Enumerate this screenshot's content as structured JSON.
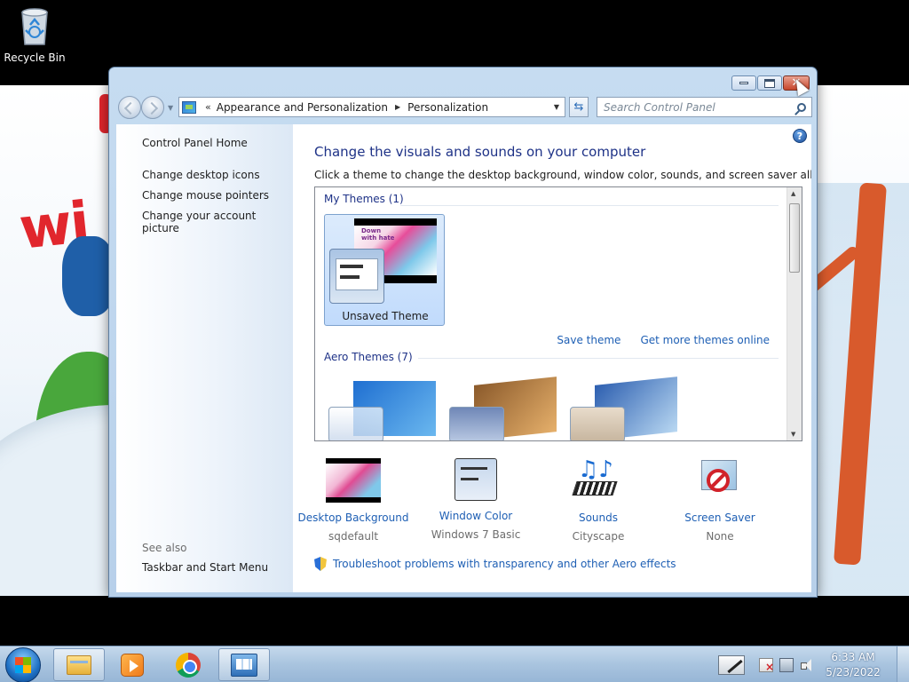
{
  "desktop": {
    "recycle_bin_label": "Recycle Bin",
    "wallpaper_text": "wi"
  },
  "window": {
    "breadcrumb": {
      "prefix": "«",
      "items": [
        "Appearance and Personalization",
        "Personalization"
      ]
    },
    "search_placeholder": "Search Control Panel",
    "left_pane": {
      "home": "Control Panel Home",
      "links": [
        "Change desktop icons",
        "Change mouse pointers",
        "Change your account picture"
      ],
      "see_also_label": "See also",
      "see_also_links": [
        "Taskbar and Start Menu"
      ]
    },
    "main": {
      "title": "Change the visuals and sounds on your computer",
      "subtitle": "Click a theme to change the desktop background, window color, sounds, and screen saver all at once.",
      "my_themes_label": "My Themes (1)",
      "my_themes": [
        {
          "name": "Unsaved Theme",
          "selected": true,
          "background_text": "Down with hate"
        }
      ],
      "save_theme_link": "Save theme",
      "get_more_link": "Get more themes online",
      "aero_themes_label": "Aero Themes (7)",
      "aero_themes_visible": [
        {
          "icon": "windows7-theme-icon",
          "colors": [
            "#1f6fd1",
            "#6bb8ef"
          ]
        },
        {
          "icon": "architecture-theme-icon",
          "colors": [
            "#8b5a2b",
            "#e6b06b"
          ]
        },
        {
          "icon": "characters-theme-icon",
          "colors": [
            "#2d5fb0",
            "#b9d8f2"
          ]
        }
      ],
      "settings": [
        {
          "title": "Desktop Background",
          "value": "sqdefault",
          "icon": "desktop-background-icon"
        },
        {
          "title": "Window Color",
          "value": "Windows 7 Basic",
          "icon": "window-color-icon"
        },
        {
          "title": "Sounds",
          "value": "Cityscape",
          "icon": "sounds-icon"
        },
        {
          "title": "Screen Saver",
          "value": "None",
          "icon": "screen-saver-icon"
        }
      ],
      "troubleshoot_link": "Troubleshoot problems with transparency and other Aero effects"
    }
  },
  "taskbar": {
    "pinned": [
      {
        "name": "windows-explorer",
        "icon": "folder-icon"
      },
      {
        "name": "windows-media-player",
        "icon": "media-player-icon"
      },
      {
        "name": "google-chrome",
        "icon": "chrome-icon"
      },
      {
        "name": "control-panel",
        "icon": "control-panel-icon",
        "active": true
      }
    ],
    "clock": {
      "time": "6:33 AM",
      "date": "5/23/2022"
    }
  }
}
